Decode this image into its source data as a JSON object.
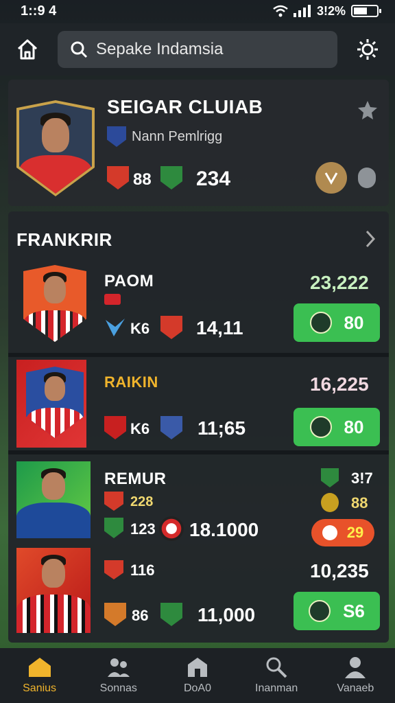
{
  "status": {
    "time": "1::9 4",
    "battery": "3!2%",
    "battery_level": 0.6
  },
  "search": {
    "query": "Sepake Indamsia"
  },
  "featured": {
    "title": "SEIGAR CLUIAB",
    "subtitle": "Nann Pemlrigg",
    "rating": "88",
    "value": "234"
  },
  "section": {
    "title": "FRANKRIR"
  },
  "players": [
    {
      "name": "PAOM",
      "stat_label": "K6",
      "value": "14,11",
      "price": "23,222",
      "score": "80",
      "score_color": "#3bbf52"
    },
    {
      "name": "RAIKIN",
      "stat_label": "K6",
      "value": "11;65",
      "price": "16,225",
      "score": "80",
      "score_color": "#3bbf52"
    },
    {
      "name": "REMUR",
      "stat_label_a": "228",
      "stat_label_b": "123",
      "value": "18.1000",
      "side_a": "3!7",
      "side_b": "88",
      "score": "29",
      "score_color": "#e8522a"
    },
    {
      "stat_label_a": "116",
      "stat_label_b": "86",
      "value": "11,000",
      "price": "10,235",
      "score": "S6",
      "score_color": "#3bbf52"
    }
  ],
  "tabs": [
    {
      "label": "Sanius",
      "icon": "home-icon",
      "active": true
    },
    {
      "label": "Sonnas",
      "icon": "people-icon",
      "active": false
    },
    {
      "label": "DoA0",
      "icon": "building-icon",
      "active": false
    },
    {
      "label": "Inanman",
      "icon": "search-person-icon",
      "active": false
    },
    {
      "label": "Vanaeb",
      "icon": "profile-icon",
      "active": false
    }
  ],
  "colors": {
    "accent": "#f0b42c",
    "green": "#3bbf52",
    "red": "#e8522a",
    "card": "#262a2e"
  }
}
